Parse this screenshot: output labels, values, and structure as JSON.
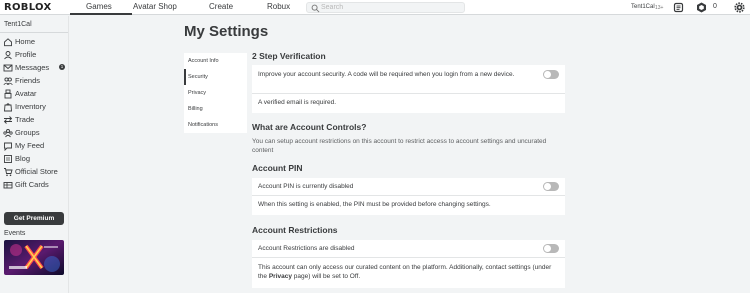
{
  "topbar": {
    "logo": "ROBLOX",
    "nav": [
      "Games",
      "Avatar Shop",
      "Create",
      "Robux"
    ],
    "search_placeholder": "Search",
    "username": "Tent1Cal",
    "age": "13+",
    "robux_count": "0"
  },
  "sidebar": {
    "username": "Tent1Cal",
    "items": [
      {
        "label": "Home",
        "icon": "home-icon"
      },
      {
        "label": "Profile",
        "icon": "profile-icon"
      },
      {
        "label": "Messages",
        "icon": "messages-icon",
        "badge": "1"
      },
      {
        "label": "Friends",
        "icon": "friends-icon"
      },
      {
        "label": "Avatar",
        "icon": "avatar-icon"
      },
      {
        "label": "Inventory",
        "icon": "inventory-icon"
      },
      {
        "label": "Trade",
        "icon": "trade-icon"
      },
      {
        "label": "Groups",
        "icon": "groups-icon"
      },
      {
        "label": "My Feed",
        "icon": "feed-icon"
      },
      {
        "label": "Blog",
        "icon": "blog-icon"
      },
      {
        "label": "Official Store",
        "icon": "store-icon"
      },
      {
        "label": "Gift Cards",
        "icon": "gift-card-icon"
      }
    ],
    "premium_label": "Get Premium",
    "events_label": "Events"
  },
  "main": {
    "title": "My Settings",
    "menu": [
      "Account Info",
      "Security",
      "Privacy",
      "Billing",
      "Notifications"
    ],
    "active_menu": "Security",
    "two_step": {
      "heading": "2 Step Verification",
      "text": "Improve your account security. A code will be required when you login from a new device.",
      "note": "A verified email is required.",
      "enabled": false
    },
    "controls": {
      "heading": "What are Account Controls?",
      "text": "You can setup account restrictions on this account to restrict access to account settings and uncurated content"
    },
    "pin": {
      "heading": "Account PIN",
      "status": "Account PIN is currently disabled",
      "note": "When this setting is enabled, the PIN must be provided before changing settings.",
      "enabled": false
    },
    "restrictions": {
      "heading": "Account Restrictions",
      "status": "Account Restrictions are disabled",
      "note_before": "This account can only access our curated content on the platform. Additionally, contact settings (under the ",
      "note_link": "Privacy",
      "note_after": " page) will be set to Off.",
      "enabled": false
    }
  },
  "colors": {
    "text": "#393b3d",
    "background": "#f2f4f5",
    "card": "#ffffff",
    "toggle_off": "#b8b8b8"
  }
}
